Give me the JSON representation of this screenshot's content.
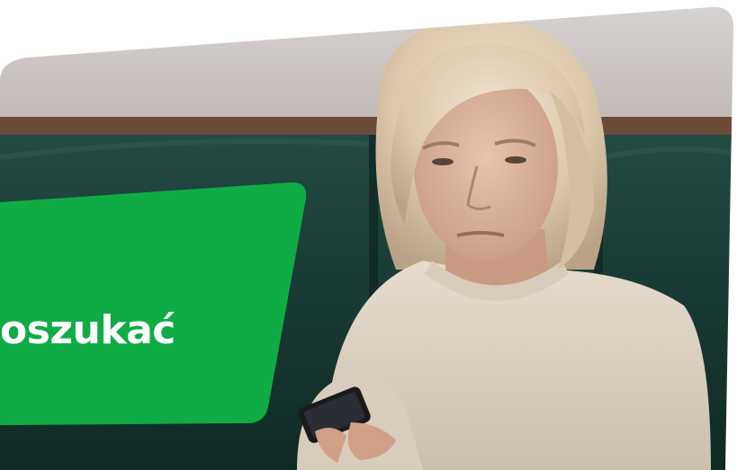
{
  "banner": {
    "headline": "oszukać",
    "color": "#0fac46"
  },
  "photo": {
    "subject": "woman-looking-at-phone"
  }
}
